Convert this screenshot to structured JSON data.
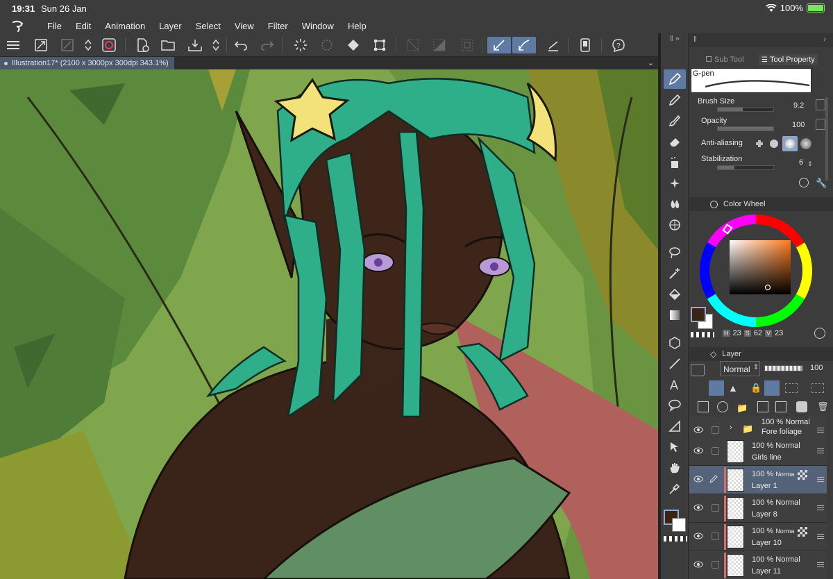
{
  "status": {
    "time": "19:31",
    "date": "Sun 26 Jan",
    "battery_percent": "100%"
  },
  "menu": {
    "items": [
      "File",
      "Edit",
      "Animation",
      "Layer",
      "Select",
      "View",
      "Filter",
      "Window",
      "Help"
    ]
  },
  "document": {
    "tab_title": "Illustration17* (2100 x 3000px 300dpi 343.1%)"
  },
  "subtool": {
    "tab_subtool": "Sub Tool",
    "tab_tool_property": "Tool Property",
    "brush_name": "G-pen",
    "props": [
      {
        "label": "Brush Size",
        "value": "9.2",
        "fill": 0.55
      },
      {
        "label": "Opacity",
        "value": "100",
        "fill": 1.0
      },
      {
        "label": "Anti-aliasing",
        "value": ""
      },
      {
        "label": "Stabilization",
        "value": "6",
        "fill": 0.3
      }
    ]
  },
  "color_wheel": {
    "title": "Color Wheel",
    "h_label": "H",
    "h_value": "23",
    "s_label": "S",
    "s_value": "62",
    "v_label": "V",
    "v_value": "23",
    "main_color": "#3a2418",
    "sub_color": "#ffffff"
  },
  "layer_panel": {
    "title": "Layer",
    "blend_mode": "Normal",
    "opacity": "100",
    "layers": [
      {
        "percent": "100 %",
        "mode": "Normal",
        "name": "Fore foliage",
        "folder": true
      },
      {
        "percent": "100 %",
        "mode": "Normal",
        "name": "Girls line"
      },
      {
        "percent": "100 %",
        "mode": "Norma",
        "name": "Layer 1",
        "selected": true
      },
      {
        "percent": "100 %",
        "mode": "Normal",
        "name": "Layer 8"
      },
      {
        "percent": "100 %",
        "mode": "Norma",
        "name": "Layer 10"
      },
      {
        "percent": "100 %",
        "mode": "Normal",
        "name": "Layer 11"
      }
    ]
  }
}
